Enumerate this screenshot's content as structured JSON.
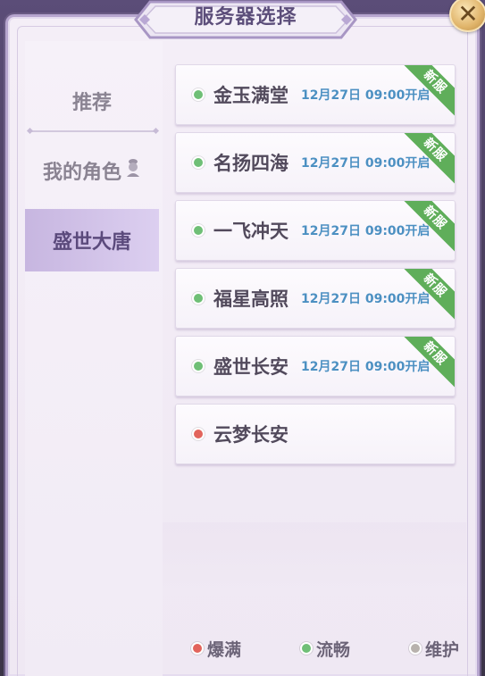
{
  "title": "服务器选择",
  "close_symbol": "✕",
  "colors": {
    "full": "#e2645c",
    "smooth": "#6fbf76",
    "maintenance": "#b8b2ad",
    "new_badge": "#5fae5a",
    "time_text": "#4c90c2",
    "active_tab": "#c7b6e0"
  },
  "sidebar": {
    "items": [
      {
        "label": "推荐",
        "active": false
      },
      {
        "label": "我的角色",
        "active": false,
        "icon": "character-head-icon"
      },
      {
        "label": "盛世大唐",
        "active": true
      }
    ]
  },
  "servers": [
    {
      "name": "金玉满堂",
      "time": "12月27日 09:00开启",
      "status": "smooth",
      "badge": "新服"
    },
    {
      "name": "名扬四海",
      "time": "12月27日 09:00开启",
      "status": "smooth",
      "badge": "新服"
    },
    {
      "name": "一飞冲天",
      "time": "12月27日 09:00开启",
      "status": "smooth",
      "badge": "新服"
    },
    {
      "name": "福星高照",
      "time": "12月27日 09:00开启",
      "status": "smooth",
      "badge": "新服"
    },
    {
      "name": "盛世长安",
      "time": "12月27日 09:00开启",
      "status": "smooth",
      "badge": "新服"
    },
    {
      "name": "云梦长安",
      "time": "",
      "status": "full",
      "badge": ""
    }
  ],
  "legend": [
    {
      "label": "爆满",
      "status": "full"
    },
    {
      "label": "流畅",
      "status": "smooth"
    },
    {
      "label": "维护",
      "status": "maintenance"
    }
  ]
}
